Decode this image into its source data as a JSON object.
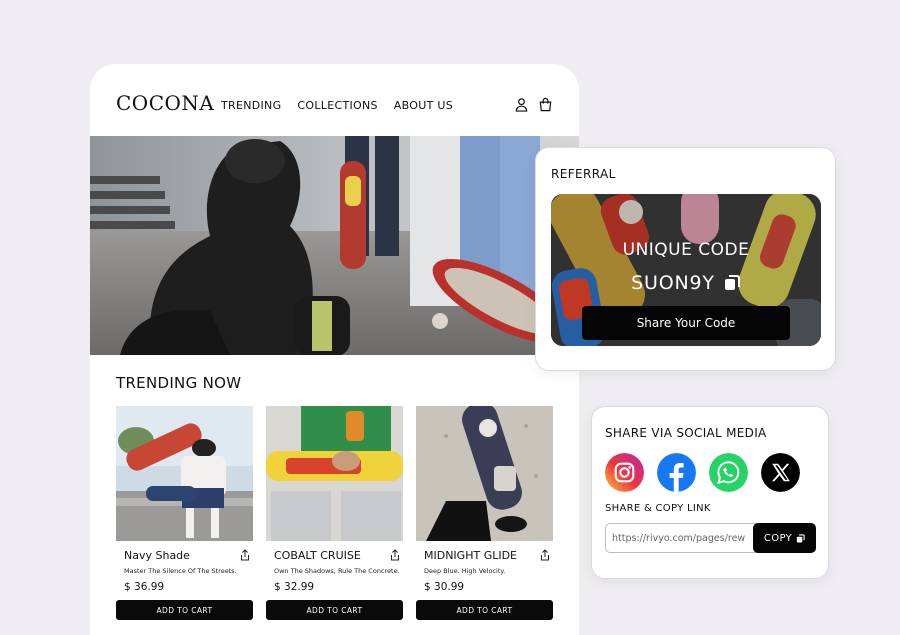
{
  "brand": {
    "logo": "COCONA"
  },
  "nav": {
    "links": [
      "TRENDING",
      "COLLECTIONS",
      "ABOUT US"
    ]
  },
  "trending": {
    "title": "TRENDING NOW",
    "products": [
      {
        "name": "Navy Shade",
        "tagline": "Master The Silence Of The Streets.",
        "price": "$ 36.99",
        "button": "ADD TO CART"
      },
      {
        "name": "COBALT CRUISE",
        "tagline": "Own The Shadows, Rule The Concrete.",
        "price": "$ 32.99",
        "button": "ADD TO CART"
      },
      {
        "name": "MIDNIGHT GLIDE",
        "tagline": "Deep Blue. High Velocity.",
        "price": "$ 30.99",
        "button": "ADD TO CART"
      }
    ]
  },
  "referral": {
    "title": "REFERRAL",
    "label": "UNIQUE CODE",
    "code": "SUON9Y",
    "share_button": "Share Your Code"
  },
  "social": {
    "title": "SHARE VIA SOCIAL MEDIA",
    "networks": [
      "instagram-icon",
      "facebook-icon",
      "whatsapp-icon",
      "x-icon"
    ],
    "copy_title": "SHARE & COPY LINK",
    "link_value": "https://rivyo.com/pages/rew",
    "copy_button": "COPY"
  },
  "colors": {
    "background": "#efedf1",
    "button": "#050505",
    "facebook": "#1877f2",
    "whatsapp": "#25d366"
  }
}
